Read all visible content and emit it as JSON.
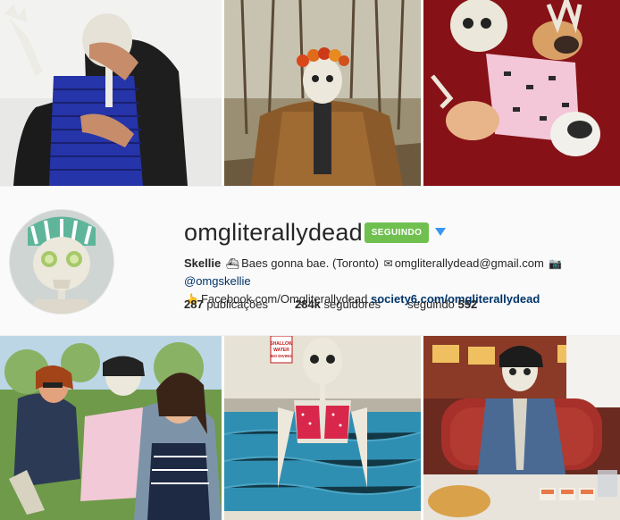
{
  "profile": {
    "username": "omgliterallydead",
    "follow_label": "SEGUINDO",
    "bio_name": "Skellie",
    "bio_text": "Baes gonna bae. (Toronto)",
    "email": "omgliterallydead@gmail.com",
    "mention": "@omgskellie",
    "facebook": "Facebook.com/Omgliterallydead",
    "site_link": "society6.com/omgliterallydead",
    "icons": [
      "ship-emoji",
      "envelope-emoji",
      "camera-emoji",
      "pointing-hand-emoji"
    ]
  },
  "stats": {
    "posts_count": "287",
    "posts_label": "publicações",
    "followers_count": "284k",
    "followers_label": "seguidores",
    "following_label": "seguindo",
    "following_count": "552"
  },
  "photo7_sign": {
    "line1": "SHALLOW",
    "line2": "WATER",
    "line3": "NO DIVING"
  },
  "colors": {
    "follow_button": "#70c050",
    "link": "#003569",
    "dropdown_arrow": "#3897f0"
  }
}
